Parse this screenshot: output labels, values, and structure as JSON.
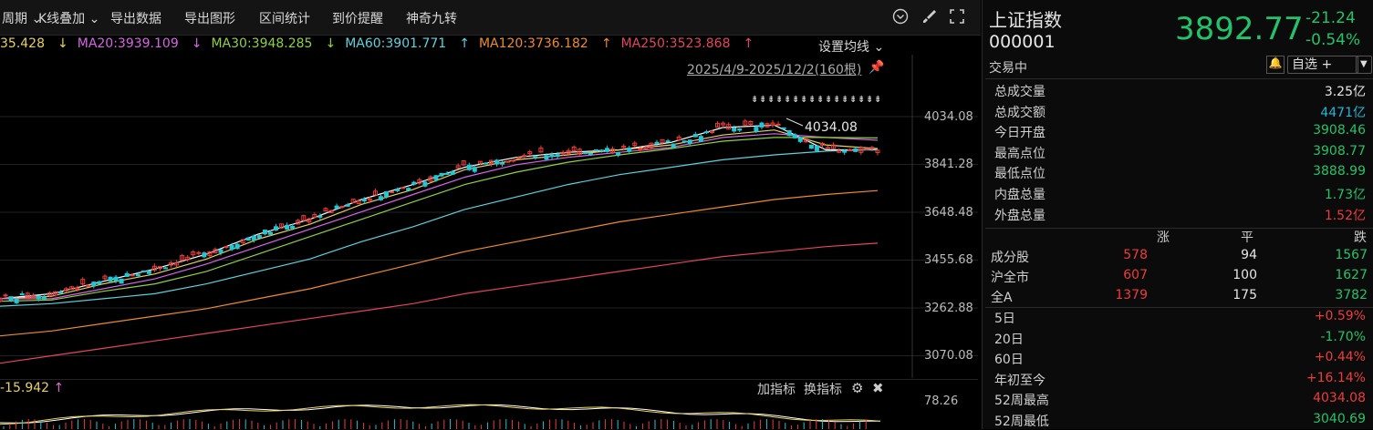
{
  "toolbar": {
    "items": [
      "周期",
      "K线叠加",
      "导出数据",
      "导出图形",
      "区间统计",
      "到价提醒",
      "神奇九转"
    ]
  },
  "ma_row": {
    "items": [
      {
        "text": "35.428",
        "arrow": "↓",
        "color": "#e8d15b"
      },
      {
        "text": "MA20:3939.109",
        "arrow": "↓",
        "color": "#d864e6"
      },
      {
        "text": "MA30:3948.285",
        "arrow": "↓",
        "color": "#8fd13f"
      },
      {
        "text": "MA60:3901.771",
        "arrow": "↑",
        "color": "#5ad3df"
      },
      {
        "text": "MA120:3736.182",
        "arrow": "↑",
        "color": "#f08a2a"
      },
      {
        "text": "MA250:3523.868",
        "arrow": "↑",
        "color": "#e5445f"
      }
    ],
    "settings_label": "设置均线"
  },
  "range_label": "2025/4/9-2025/12/2(160根)",
  "peak_label": "4034.08",
  "chart_data": {
    "type": "candlestick",
    "y_ticks": [
      "4034.08",
      "3841.28",
      "3648.48",
      "3455.68",
      "3262.88",
      "3070.08"
    ],
    "y_range": [
      3000,
      4100
    ],
    "high": 4034.08,
    "ma_lines": {
      "ma5": [
        3300,
        3320,
        3370,
        3420,
        3480,
        3560,
        3620,
        3700,
        3760,
        3830,
        3870,
        3890,
        3900,
        3930,
        3990,
        4000,
        3900,
        3900
      ],
      "ma10": [
        3300,
        3310,
        3360,
        3400,
        3460,
        3540,
        3600,
        3680,
        3740,
        3820,
        3860,
        3880,
        3900,
        3920,
        3960,
        3980,
        3920,
        3905
      ],
      "ma20": [
        3300,
        3300,
        3340,
        3380,
        3440,
        3510,
        3580,
        3650,
        3720,
        3790,
        3840,
        3870,
        3890,
        3910,
        3950,
        3965,
        3950,
        3939
      ],
      "ma30": [
        3290,
        3295,
        3330,
        3360,
        3410,
        3480,
        3550,
        3620,
        3690,
        3760,
        3810,
        3850,
        3880,
        3905,
        3935,
        3950,
        3950,
        3948
      ],
      "ma60": [
        3270,
        3280,
        3300,
        3320,
        3360,
        3410,
        3460,
        3530,
        3590,
        3660,
        3710,
        3760,
        3800,
        3830,
        3860,
        3880,
        3895,
        3902
      ],
      "ma120": [
        3150,
        3170,
        3200,
        3230,
        3260,
        3300,
        3340,
        3390,
        3440,
        3490,
        3530,
        3570,
        3610,
        3640,
        3670,
        3700,
        3720,
        3736
      ],
      "ma250": [
        3040,
        3070,
        3100,
        3130,
        3160,
        3190,
        3220,
        3250,
        3280,
        3320,
        3350,
        3380,
        3410,
        3440,
        3470,
        3490,
        3510,
        3524
      ]
    },
    "sub_label": "-15.942",
    "sub_arrow": "↑",
    "sub_tick": "78.26"
  },
  "sub_panel": {
    "add_indicator": "加指标",
    "switch_indicator": "换指标"
  },
  "right": {
    "name": "上证指数",
    "code": "000001",
    "price": "3892.77",
    "change": "-21.24",
    "change_pct": "-0.54%",
    "status": "交易中",
    "watch_label": "自选 +",
    "stats": [
      {
        "label": "总成交量",
        "value": "3.25亿",
        "cls": "white"
      },
      {
        "label": "总成交额",
        "value": "4471亿",
        "cls": "cyan"
      },
      {
        "label": "今日开盘",
        "value": "3908.46",
        "cls": "green"
      },
      {
        "label": "最高点位",
        "value": "3908.77",
        "cls": "green"
      },
      {
        "label": "最低点位",
        "value": "3888.99",
        "cls": "green"
      },
      {
        "label": "内盘总量",
        "value": "1.73亿",
        "cls": "green"
      },
      {
        "label": "外盘总量",
        "value": "1.52亿",
        "cls": "red"
      }
    ],
    "breadth_headers": [
      "涨",
      "平",
      "跌"
    ],
    "breadth": [
      {
        "label": "成分股",
        "up": "578",
        "flat": "94",
        "down": "1567"
      },
      {
        "label": "沪全市",
        "up": "607",
        "flat": "100",
        "down": "1627"
      },
      {
        "label": "全A",
        "up": "1379",
        "flat": "175",
        "down": "3782"
      }
    ],
    "perf": [
      {
        "label": "5日",
        "value": "+0.59%",
        "cls": "red"
      },
      {
        "label": "20日",
        "value": "-1.70%",
        "cls": "green"
      },
      {
        "label": "60日",
        "value": "+0.44%",
        "cls": "red"
      },
      {
        "label": "年初至今",
        "value": "+16.14%",
        "cls": "red"
      },
      {
        "label": "52周最高",
        "value": "4034.08",
        "cls": "red"
      },
      {
        "label": "52周最低",
        "value": "3040.69",
        "cls": "green"
      }
    ]
  }
}
